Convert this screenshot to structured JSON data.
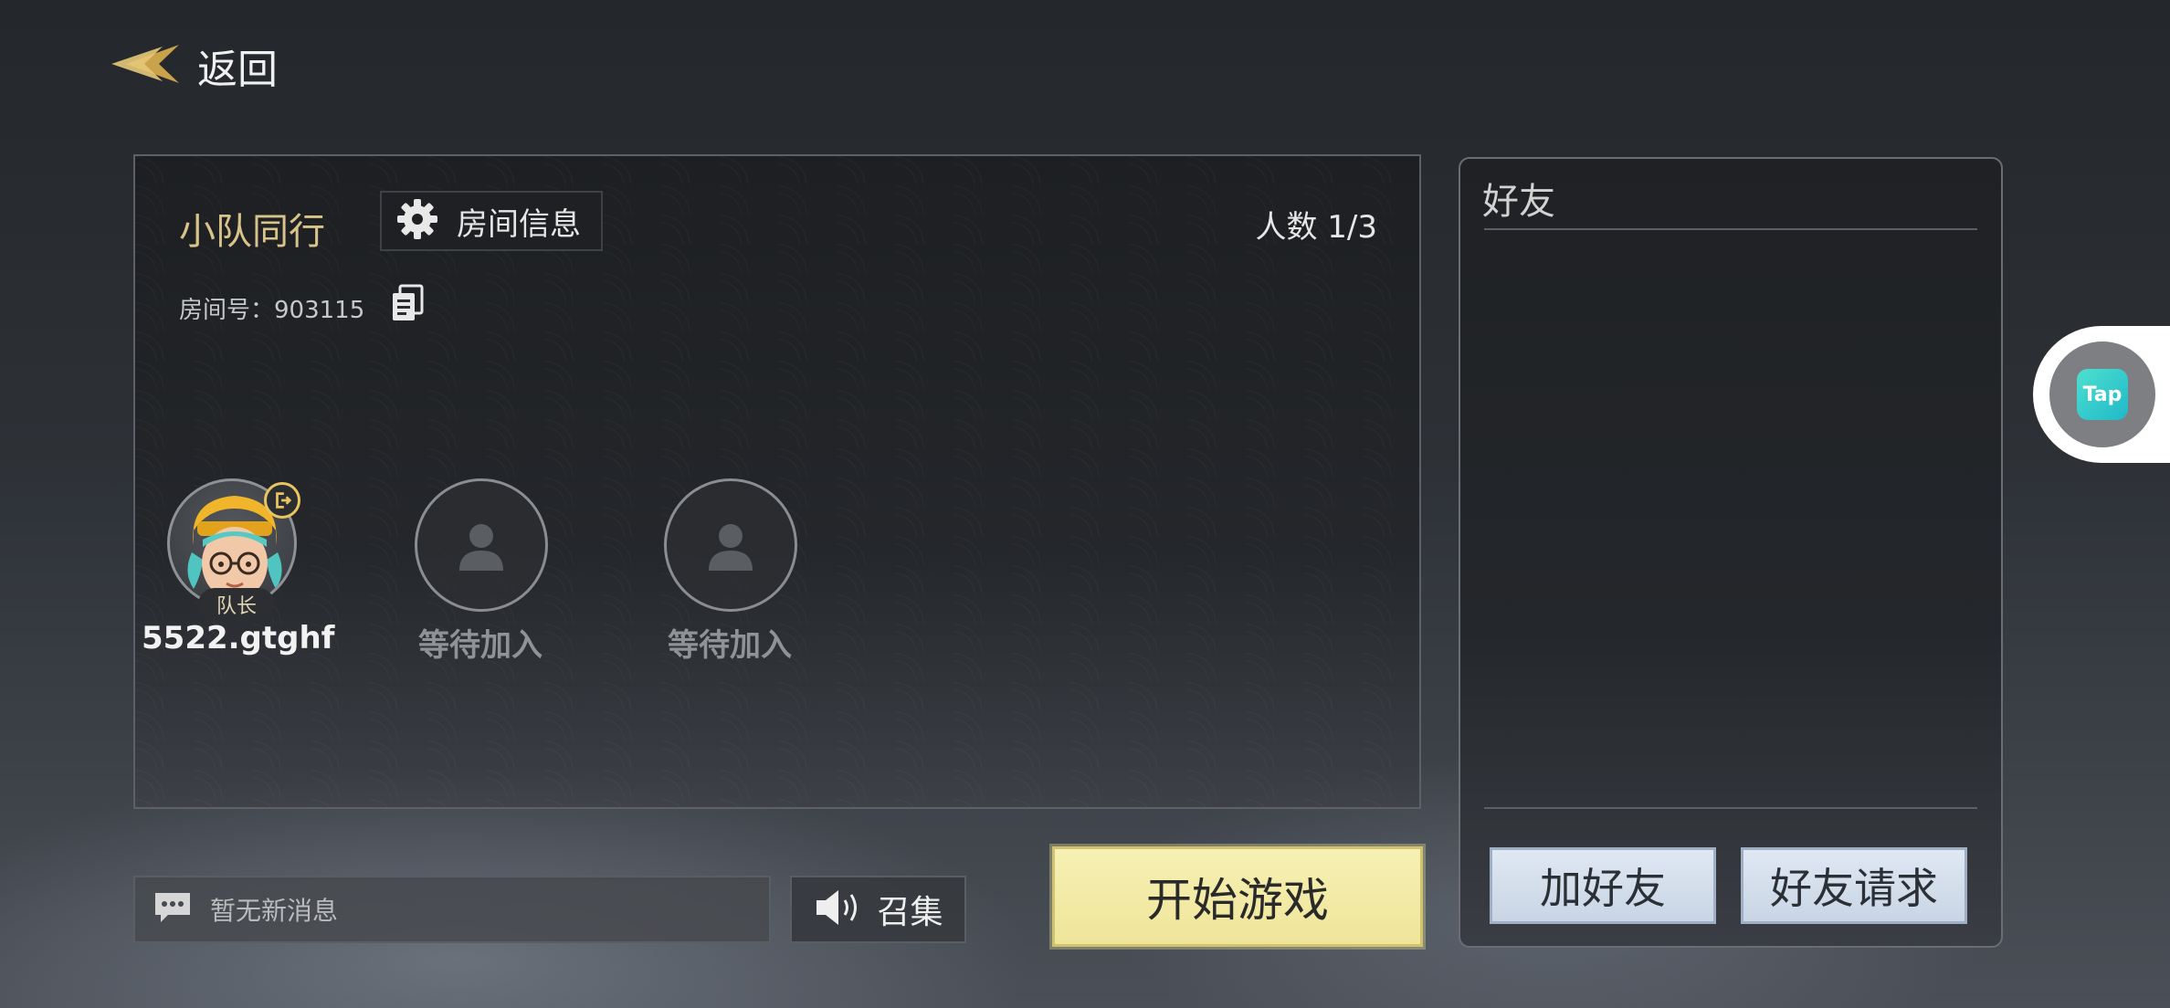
{
  "header": {
    "back_label": "返回"
  },
  "team": {
    "title": "小队同行",
    "room_info_label": "房间信息",
    "member_count": "人数 1/3",
    "room_number": "房间号：903115",
    "slots": [
      {
        "name": "5522.gtghf",
        "badge": "队长"
      },
      {
        "name": "等待加入"
      },
      {
        "name": "等待加入"
      }
    ]
  },
  "bottom": {
    "message_placeholder": "暂无新消息",
    "summon_label": "召集",
    "start_label": "开始游戏"
  },
  "friends": {
    "title": "好友",
    "add_label": "加好友",
    "requests_label": "好友请求"
  },
  "floating": {
    "tap_label": "Tap"
  },
  "colors": {
    "accent_gold": "#d8c38a",
    "start_button": "#f6f0b3",
    "friend_button": "#dfe8f3",
    "tap_brand": "#1fb8c8"
  }
}
